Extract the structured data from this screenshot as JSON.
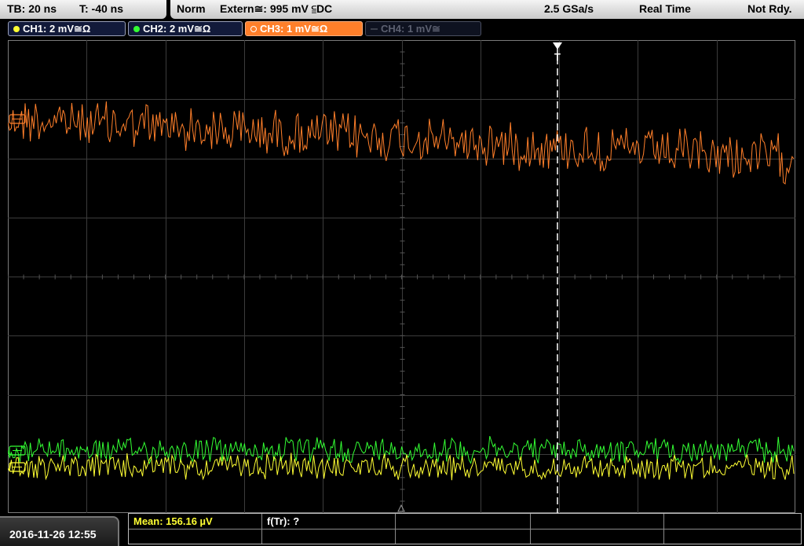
{
  "status": {
    "timebase": "TB: 20 ns",
    "trigger_time": "T: -40 ns",
    "trigger_mode": "Norm",
    "trigger_source": "Extern≅: 995 mV ⫅DC",
    "sample_rate": "2.5 GSa/s",
    "acquisition": "Real Time",
    "state": "Not Rdy."
  },
  "channels": [
    {
      "label": "CH1: 2 mV≅Ω",
      "color": "#ffff33"
    },
    {
      "label": "CH2: 2 mV≅Ω",
      "color": "#33ff33"
    },
    {
      "label": "CH3: 1 mV≅Ω",
      "color": "#ff7f2a"
    },
    {
      "label": "CH4: 1 mV≅",
      "color": "#5c6070"
    }
  ],
  "plot": {
    "trigger_marker": "T"
  },
  "bottom": {
    "datetime": "2016-11-26 12:55",
    "mean": "Mean: 156.16 µV",
    "ftr": "f(Tr): ?"
  }
}
